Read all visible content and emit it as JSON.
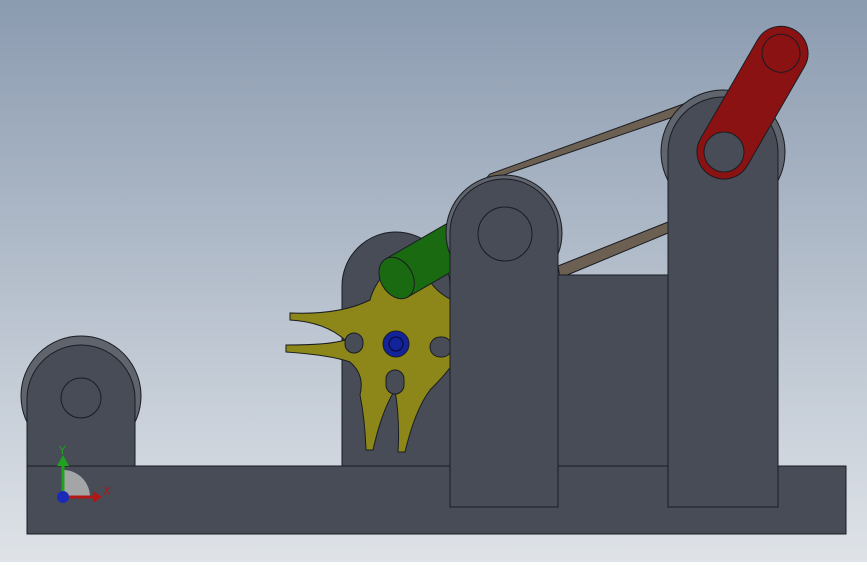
{
  "viewport": {
    "background_top": "#8b9bb0",
    "background_bottom": "#dfe3e8"
  },
  "colors": {
    "steel": "#474c57",
    "steel_edge": "#1a1c22",
    "belt": "#6c6052",
    "wheel": "#5f646d",
    "crank": "#8a1212",
    "roller": "#1a6a12",
    "star": "#8c8718",
    "hub": "#13239a"
  },
  "triad": {
    "y_label": "Y",
    "x_label": "X",
    "y_color": "#1fa31f",
    "x_color": "#b01818",
    "z_color": "#1b2bb8"
  }
}
